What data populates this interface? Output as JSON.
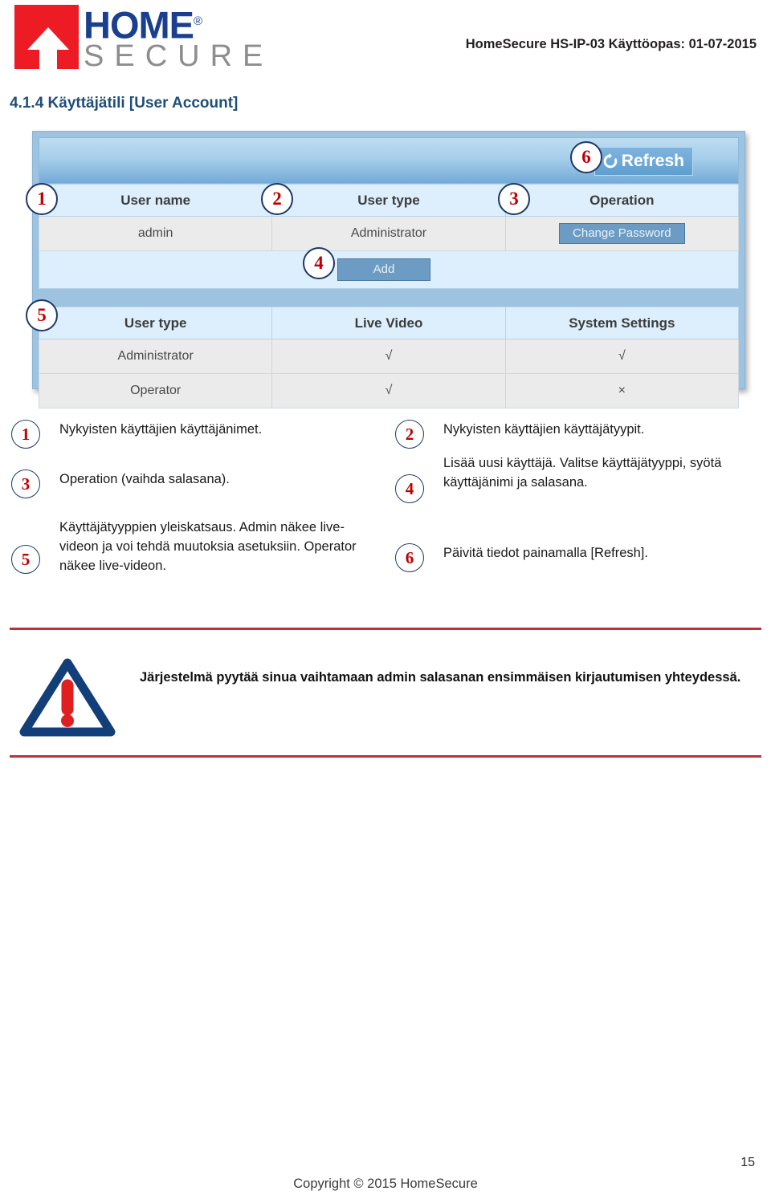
{
  "header": {
    "logo": {
      "word_top": "HOME",
      "registered_mark": "®",
      "word_bottom": "SECURE",
      "color_red": "#ed1c24",
      "color_blue": "#1b3f8f",
      "color_gray": "#8d8d8d"
    },
    "reference": "HomeSecure HS-IP-03 Käyttöopas: 01-07-2015"
  },
  "section": {
    "title": "4.1.4 Käyttäjätili [User Account]",
    "title_color": "#1f4e79"
  },
  "screenshot": {
    "toolbar": {
      "refresh_label": "Refresh",
      "refresh_icon": "refresh-circular-arrows-icon",
      "callout": "6"
    },
    "users_table": {
      "headers": [
        "User name",
        "User type",
        "Operation"
      ],
      "header_callouts": [
        "1",
        "2",
        "3"
      ],
      "rows": [
        {
          "user_name": "admin",
          "user_type": "Administrator",
          "operation_button": "Change Password"
        }
      ],
      "add_button": "Add",
      "add_callout": "4"
    },
    "permissions_table": {
      "callout": "5",
      "headers": [
        "User type",
        "Live Video",
        "System Settings"
      ],
      "rows": [
        {
          "user_type": "Administrator",
          "live_video": "√",
          "system_settings": "√"
        },
        {
          "user_type": "Operator",
          "live_video": "√",
          "system_settings": "×"
        }
      ]
    }
  },
  "legend": {
    "left": [
      {
        "num": "1",
        "text": "Nykyisten käyttäjien käyttäjänimet."
      },
      {
        "num": "3",
        "text": "Operation (vaihda salasana)."
      },
      {
        "num": "5",
        "text": "Käyttäjätyyppien yleiskatsaus. Admin näkee live-videon ja voi tehdä muutoksia asetuksiin. Operator näkee live-videon."
      }
    ],
    "right": [
      {
        "num": "2",
        "text": "Nykyisten käyttäjien käyttäjätyypit."
      },
      {
        "num": "4",
        "text": "Lisää uusi käyttäjä. Valitse käyttäjätyyppi, syötä käyttäjänimi ja salasana."
      },
      {
        "num": "6",
        "text": "Päivitä tiedot painamalla [Refresh]."
      }
    ]
  },
  "warning": {
    "icon": "warning-triangle-icon",
    "text": "Järjestelmä pyytää sinua vaihtamaan admin salasanan ensimmäisen kirjautumisen yhteydessä.",
    "rule_color": "#c0303a"
  },
  "footer": {
    "copyright": "Copyright © 2015 HomeSecure",
    "page_number": "15"
  }
}
